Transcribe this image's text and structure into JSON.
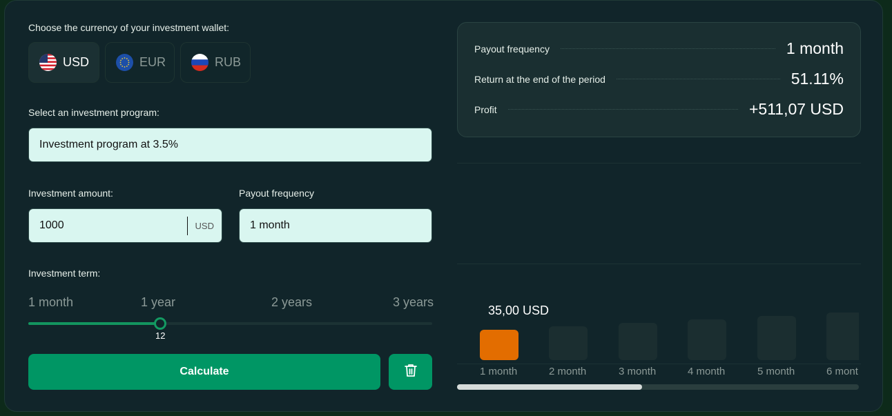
{
  "currency": {
    "label": "Choose the currency of your investment wallet:",
    "options": [
      {
        "code": "USD",
        "flag": "us-flag-icon"
      },
      {
        "code": "EUR",
        "flag": "eu-flag-icon"
      },
      {
        "code": "RUB",
        "flag": "ru-flag-icon"
      }
    ],
    "selected": "USD"
  },
  "program": {
    "label": "Select an investment program:",
    "value": "Investment program at 3.5%"
  },
  "amount": {
    "label": "Investment amount:",
    "value": "1000",
    "unit": "USD"
  },
  "frequency": {
    "label": "Payout frequency",
    "value": "1 month"
  },
  "term": {
    "label": "Investment term:",
    "marks": [
      "1 month",
      "1 year",
      "2 years",
      "3 years"
    ],
    "value": "12",
    "value_months": 12,
    "max_months": 36
  },
  "actions": {
    "calculate": "Calculate",
    "delete_icon": "trash-icon"
  },
  "summary": {
    "rows": [
      {
        "key": "Payout frequency",
        "value": "1 month"
      },
      {
        "key": "Return at the end of the period",
        "value": "51.11%"
      },
      {
        "key": "Profit",
        "value": "+511,07 USD"
      }
    ]
  },
  "payouts": {
    "selected_value": "35,00 USD",
    "items": [
      {
        "label": "1 month",
        "active": true
      },
      {
        "label": "2 month",
        "active": false
      },
      {
        "label": "3 month",
        "active": false
      },
      {
        "label": "4 month",
        "active": false
      },
      {
        "label": "5 month",
        "active": false
      },
      {
        "label": "6 mont",
        "active": false
      }
    ],
    "scroll_fraction": 0.46
  },
  "colors": {
    "accent": "#009664",
    "active_bar": "#e36d00",
    "input_bg": "#d9f6f0"
  }
}
